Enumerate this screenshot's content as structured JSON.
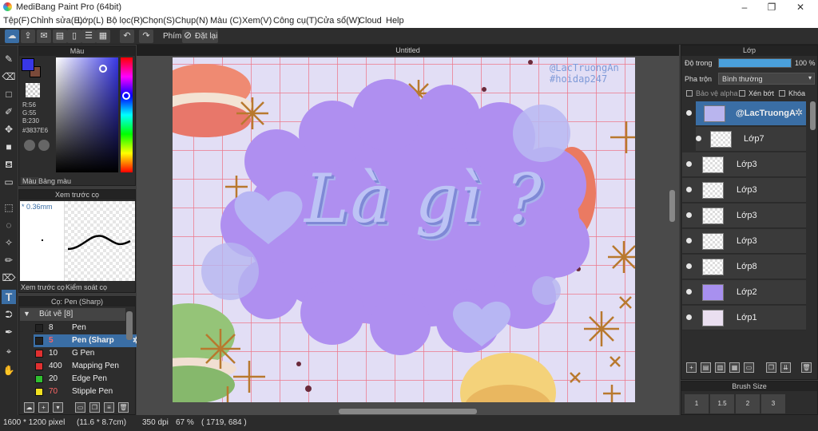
{
  "window": {
    "title": "MediBang Paint Pro (64bit)"
  },
  "menu": [
    "Tệp(F)",
    "Chỉnh sửa(E)",
    "Lớp(L)",
    "Bộ lọc(R)",
    "Chọn(S)",
    "Chụp(N)",
    "Màu (C)",
    "Xem(V)",
    "Công cụ(T)",
    "Cửa sổ(W)",
    "Cloud",
    "Help"
  ],
  "toolbar": {
    "keyboard_label": "Phím",
    "reset_label": "Đặt lại"
  },
  "color_panel": {
    "title": "Màu",
    "r": "R:56",
    "g": "G:55",
    "b": "B:230",
    "hex": "#3837E6",
    "tab_color": "Màu",
    "tab_palette": "Bảng màu",
    "primary_color": "#3837e6",
    "secondary_color": "#7a4a3a"
  },
  "preview_panel": {
    "title": "Xem trước cọ",
    "size": "* 0.36mm",
    "tab_preview": "Xem trước cọ",
    "tab_control": "Kiểm soát cọ"
  },
  "brush_panel": {
    "title": "Cọ: Pen (Sharp)",
    "group": "Bút vẽ [8]",
    "items": [
      {
        "size": "8",
        "name": "Pen",
        "color": "#222222"
      },
      {
        "size": "5",
        "name": "Pen (Sharp",
        "color": "#222222"
      },
      {
        "size": "10",
        "name": "G Pen",
        "color": "#e03030"
      },
      {
        "size": "400",
        "name": "Mapping Pen",
        "color": "#e03030"
      },
      {
        "size": "20",
        "name": "Edge Pen",
        "color": "#30c030"
      },
      {
        "size": "70",
        "name": "Stipple Pen",
        "color": "#f0e020"
      }
    ]
  },
  "document": {
    "title": "Untitled"
  },
  "artwork": {
    "watermark_line1": "@LacTruongAn",
    "watermark_line2": "#hoidap247",
    "headline": "Là gì ?"
  },
  "layer_panel": {
    "title": "Lớp",
    "opacity_label": "Độ trong",
    "opacity_value": "100 %",
    "opacity_fraction": 1.0,
    "blend_label": "Pha trộn",
    "blend_value": "Bình thường",
    "protect_alpha": "Bảo vệ alpha",
    "clipping": "Xén bớt",
    "lock": "Khóa",
    "layers": [
      "@LacTruongA",
      "Lớp7",
      "Lớp3",
      "Lớp3",
      "Lớp3",
      "Lớp3",
      "Lớp8",
      "Lớp2",
      "Lớp1"
    ]
  },
  "brush_size_panel": {
    "title": "Brush Size",
    "sizes": [
      "1",
      "1.5",
      "2",
      "3"
    ]
  },
  "status": {
    "dimensions": "1600 * 1200 pixel",
    "physical": "(11.6 * 8.7cm)",
    "dpi": "350 dpi",
    "zoom": "67 %",
    "cursor": "( 1719, 684 )"
  }
}
